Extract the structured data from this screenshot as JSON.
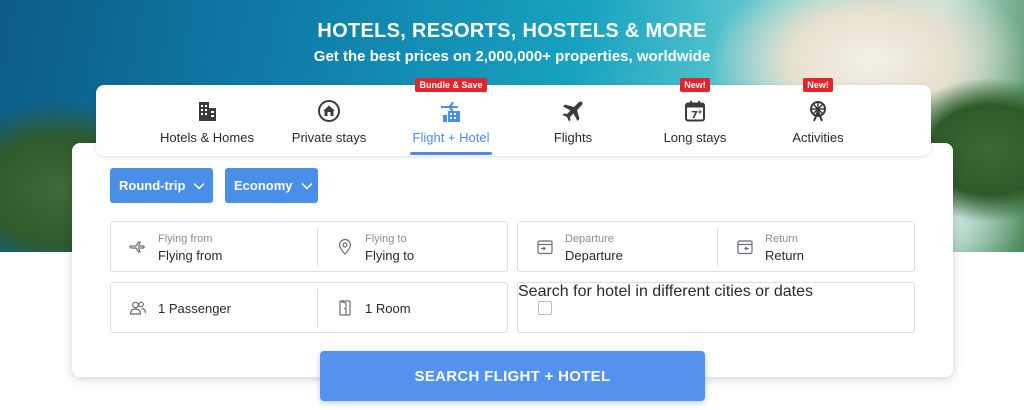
{
  "hero": {
    "title": "HOTELS, RESORTS, HOSTELS & MORE",
    "subtitle": "Get the best prices on 2,000,000+ properties, worldwide"
  },
  "tabs": [
    {
      "label": "Hotels & Homes",
      "icon": "building-icon",
      "active": false,
      "badge": ""
    },
    {
      "label": "Private stays",
      "icon": "house-icon",
      "active": false,
      "badge": ""
    },
    {
      "label": "Flight + Hotel",
      "icon": "flight-hotel-icon",
      "active": true,
      "badge": "Bundle & Save"
    },
    {
      "label": "Flights",
      "icon": "plane-icon",
      "active": false,
      "badge": ""
    },
    {
      "label": "Long stays",
      "icon": "calendar-7-icon",
      "active": false,
      "badge": "New!"
    },
    {
      "label": "Activities",
      "icon": "ferris-wheel-icon",
      "active": false,
      "badge": "New!"
    }
  ],
  "options": {
    "trip_type": "Round-trip",
    "cabin_class": "Economy"
  },
  "fields": {
    "flying_from": {
      "label": "Flying from",
      "value": "Flying from"
    },
    "flying_to": {
      "label": "Flying to",
      "value": "Flying to"
    },
    "departure": {
      "label": "Departure",
      "value": "Departure"
    },
    "return": {
      "label": "Return",
      "value": "Return"
    },
    "passengers": "1 Passenger",
    "rooms": "1 Room",
    "different_cities": "Search for hotel in different cities or dates"
  },
  "search_button": "SEARCH FLIGHT + HOTEL",
  "colors": {
    "accent": "#4a8fe7",
    "badge": "#e3242b",
    "search_button": "#5393ef"
  }
}
